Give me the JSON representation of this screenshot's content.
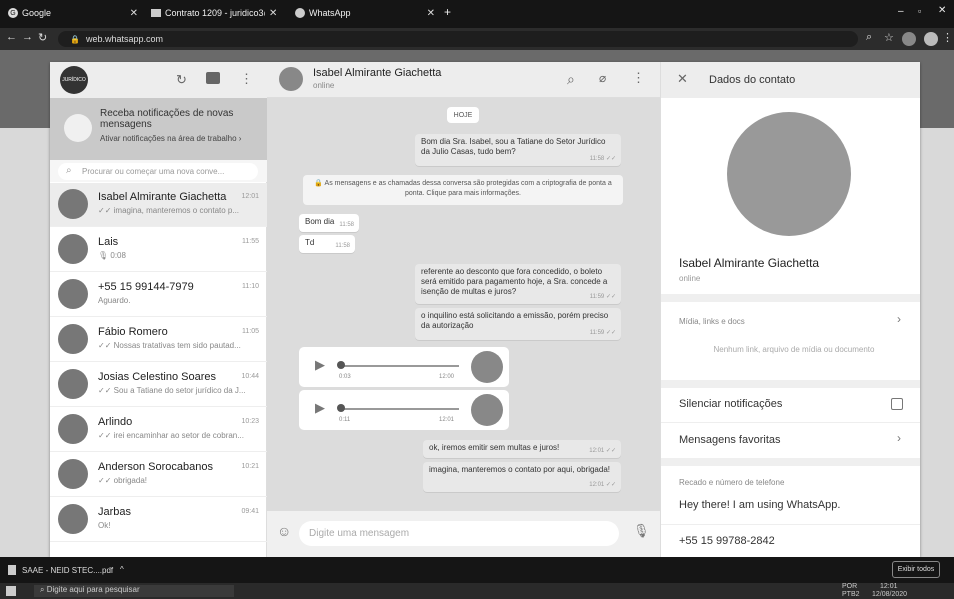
{
  "browser": {
    "tabs": [
      {
        "title": "Google"
      },
      {
        "title": "Contrato 1209 - juridico3@julio"
      },
      {
        "title": "WhatsApp"
      }
    ],
    "new_tab": "+",
    "url": "web.whatsapp.com"
  },
  "left": {
    "logo_text": "JURÍDICO",
    "notification": {
      "title": "Receba notificações de novas mensagens",
      "subtitle": "Ativar notificações na área de trabalho ›"
    },
    "search_placeholder": "Procurar ou começar uma nova conve...",
    "chats": [
      {
        "name": "Isabel Almirante Giachetta",
        "time": "12:01",
        "last": "✓✓ imagina, manteremos o contato p..."
      },
      {
        "name": "Lais",
        "time": "11:55",
        "last": "🎙 0:08"
      },
      {
        "name": "+55 15 99144-7979",
        "time": "11:10",
        "last": "Aguardo."
      },
      {
        "name": "Fábio Romero",
        "time": "11:05",
        "last": "✓✓ Nossas tratativas tem sido pautad..."
      },
      {
        "name": "Josias Celestino Soares",
        "time": "10:44",
        "last": "✓✓ Sou a Tatiane do setor jurídico da J..."
      },
      {
        "name": "Arlindo",
        "time": "10:23",
        "last": "✓✓ irei encaminhar ao setor de cobran..."
      },
      {
        "name": "Anderson Sorocabanos",
        "time": "10:21",
        "last": "✓✓ obrigada!"
      },
      {
        "name": "Jarbas",
        "time": "09:41",
        "last": "Ok!"
      }
    ]
  },
  "chat": {
    "contact_name": "Isabel Almirante Giachetta",
    "status": "online",
    "date_chip": "HOJE",
    "encryption_notice": "🔒 As mensagens e as chamadas dessa conversa são protegidas com a criptografia de ponta a ponta. Clique para mais informações.",
    "messages": [
      {
        "text": "Bom dia Sra. Isabel, sou a Tatiane do Setor Jurídico da Julio Casas, tudo bem?",
        "time": "11:58 ✓✓"
      },
      {
        "text": "Bom dia",
        "time": "11:58"
      },
      {
        "text": "Td",
        "time": "11:58"
      },
      {
        "text": "referente ao desconto que fora concedido, o boleto será emitido para pagamento hoje, a Sra. concede a isenção de multas e juros?",
        "time": "11:59 ✓✓"
      },
      {
        "text": "o inquilino está solicitando a emissão, porém preciso da autorização",
        "time": "11:59 ✓✓"
      },
      {
        "text": "ok, iremos emitir sem multas e juros!",
        "time": "12:01 ✓✓"
      },
      {
        "text": "imagina, manteremos o contato por aqui, obrigada!",
        "time": "12:01 ✓✓"
      }
    ],
    "audios": [
      {
        "duration": "0:03",
        "time": "12:00"
      },
      {
        "duration": "0:11",
        "time": "12:01"
      }
    ],
    "composer_placeholder": "Digite uma mensagem"
  },
  "contact_panel": {
    "header_title": "Dados do contato",
    "name": "Isabel Almirante Giachetta",
    "status": "online",
    "media_title": "Mídia, links e docs",
    "media_empty": "Nenhum link, arquivo de mídia ou documento",
    "mute_label": "Silenciar notificações",
    "starred_label": "Mensagens favoritas",
    "about_title": "Recado e número de telefone",
    "about_text": "Hey there! I am using WhatsApp.",
    "phone_partial": "+55 15 99788-2842"
  },
  "downloads": {
    "file": "SAAE - NEID STEC....pdf",
    "show_all": "Exibir todos"
  },
  "taskbar": {
    "search_placeholder": "Digite aqui para pesquisar",
    "lang": "POR",
    "lang2": "PTB2",
    "time": "12:01",
    "date": "12/08/2020"
  },
  "colors": {
    "accent": "#4a4a4a",
    "app_bg": "#dcdcdc"
  }
}
